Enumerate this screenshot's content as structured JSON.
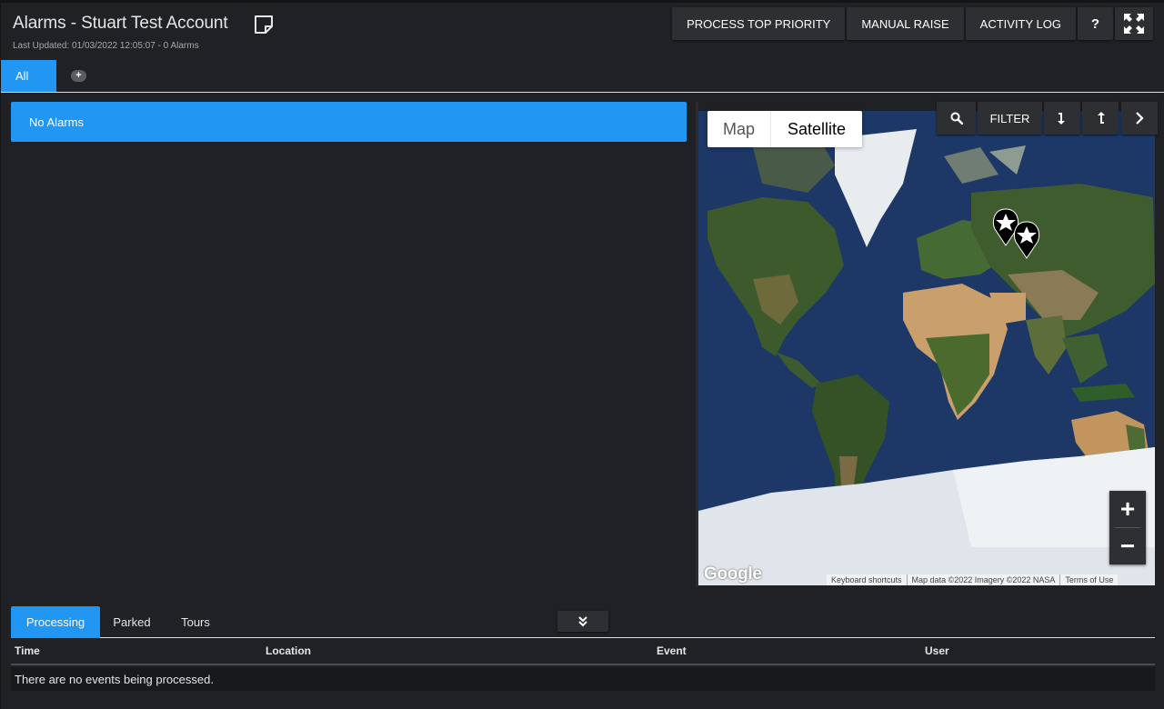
{
  "header": {
    "title": "Alarms - Stuart Test Account",
    "last_updated": "Last Updated: 01/03/2022 12:05:07 - 0 Alarms",
    "buttons": {
      "process_top_priority": "PROCESS TOP PRIORITY",
      "manual_raise": "MANUAL RAISE",
      "activity_log": "ACTIVITY LOG",
      "help": "?"
    }
  },
  "tabs": {
    "all": "All",
    "add": "+"
  },
  "alarms": {
    "banner": "No Alarms"
  },
  "map": {
    "type_map": "Map",
    "type_satellite": "Satellite",
    "selected_type": "Satellite",
    "filter": "FILTER",
    "zoom_in": "+",
    "zoom_out": "−",
    "logo": "Google",
    "attribution": {
      "shortcuts": "Keyboard shortcuts",
      "data": "Map data ©2022 Imagery ©2022 NASA",
      "terms": "Terms of Use"
    },
    "colors": {
      "ocean": "#1e3a6b",
      "land": "#3d5a2c",
      "desert": "#c9a06b",
      "ice": "#e8ecef"
    }
  },
  "bottom": {
    "tabs": [
      "Processing",
      "Parked",
      "Tours"
    ],
    "active_tab": "Processing",
    "columns": [
      "Time",
      "Location",
      "Event",
      "User"
    ],
    "empty_message": "There are no events being processed."
  },
  "colors": {
    "accent": "#2196f3",
    "background": "#202124",
    "button": "#2e2f32"
  }
}
